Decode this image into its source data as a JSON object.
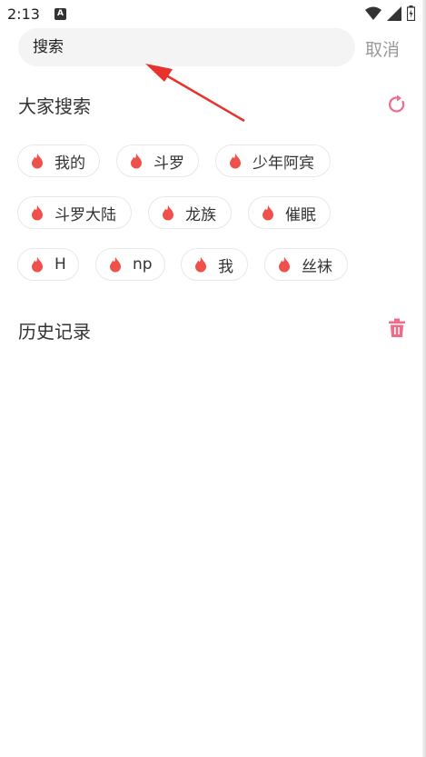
{
  "status": {
    "time": "2:13",
    "a_badge": "A"
  },
  "search": {
    "placeholder": "搜索",
    "cancel_label": "取消"
  },
  "hot": {
    "title": "大家搜索",
    "chips": [
      {
        "label": "我的"
      },
      {
        "label": "斗罗"
      },
      {
        "label": "少年阿宾"
      },
      {
        "label": "斗罗大陆"
      },
      {
        "label": "龙族"
      },
      {
        "label": "催眠"
      },
      {
        "label": "H"
      },
      {
        "label": "np"
      },
      {
        "label": "我"
      },
      {
        "label": "丝袜"
      }
    ]
  },
  "history": {
    "title": "历史记录"
  },
  "colors": {
    "accent": "#f06a8a",
    "flame": "#f0504a",
    "cancel": "#9a9a9a"
  },
  "icons": {
    "refresh": "refresh-icon",
    "trash": "trash-icon",
    "flame": "flame-icon"
  }
}
